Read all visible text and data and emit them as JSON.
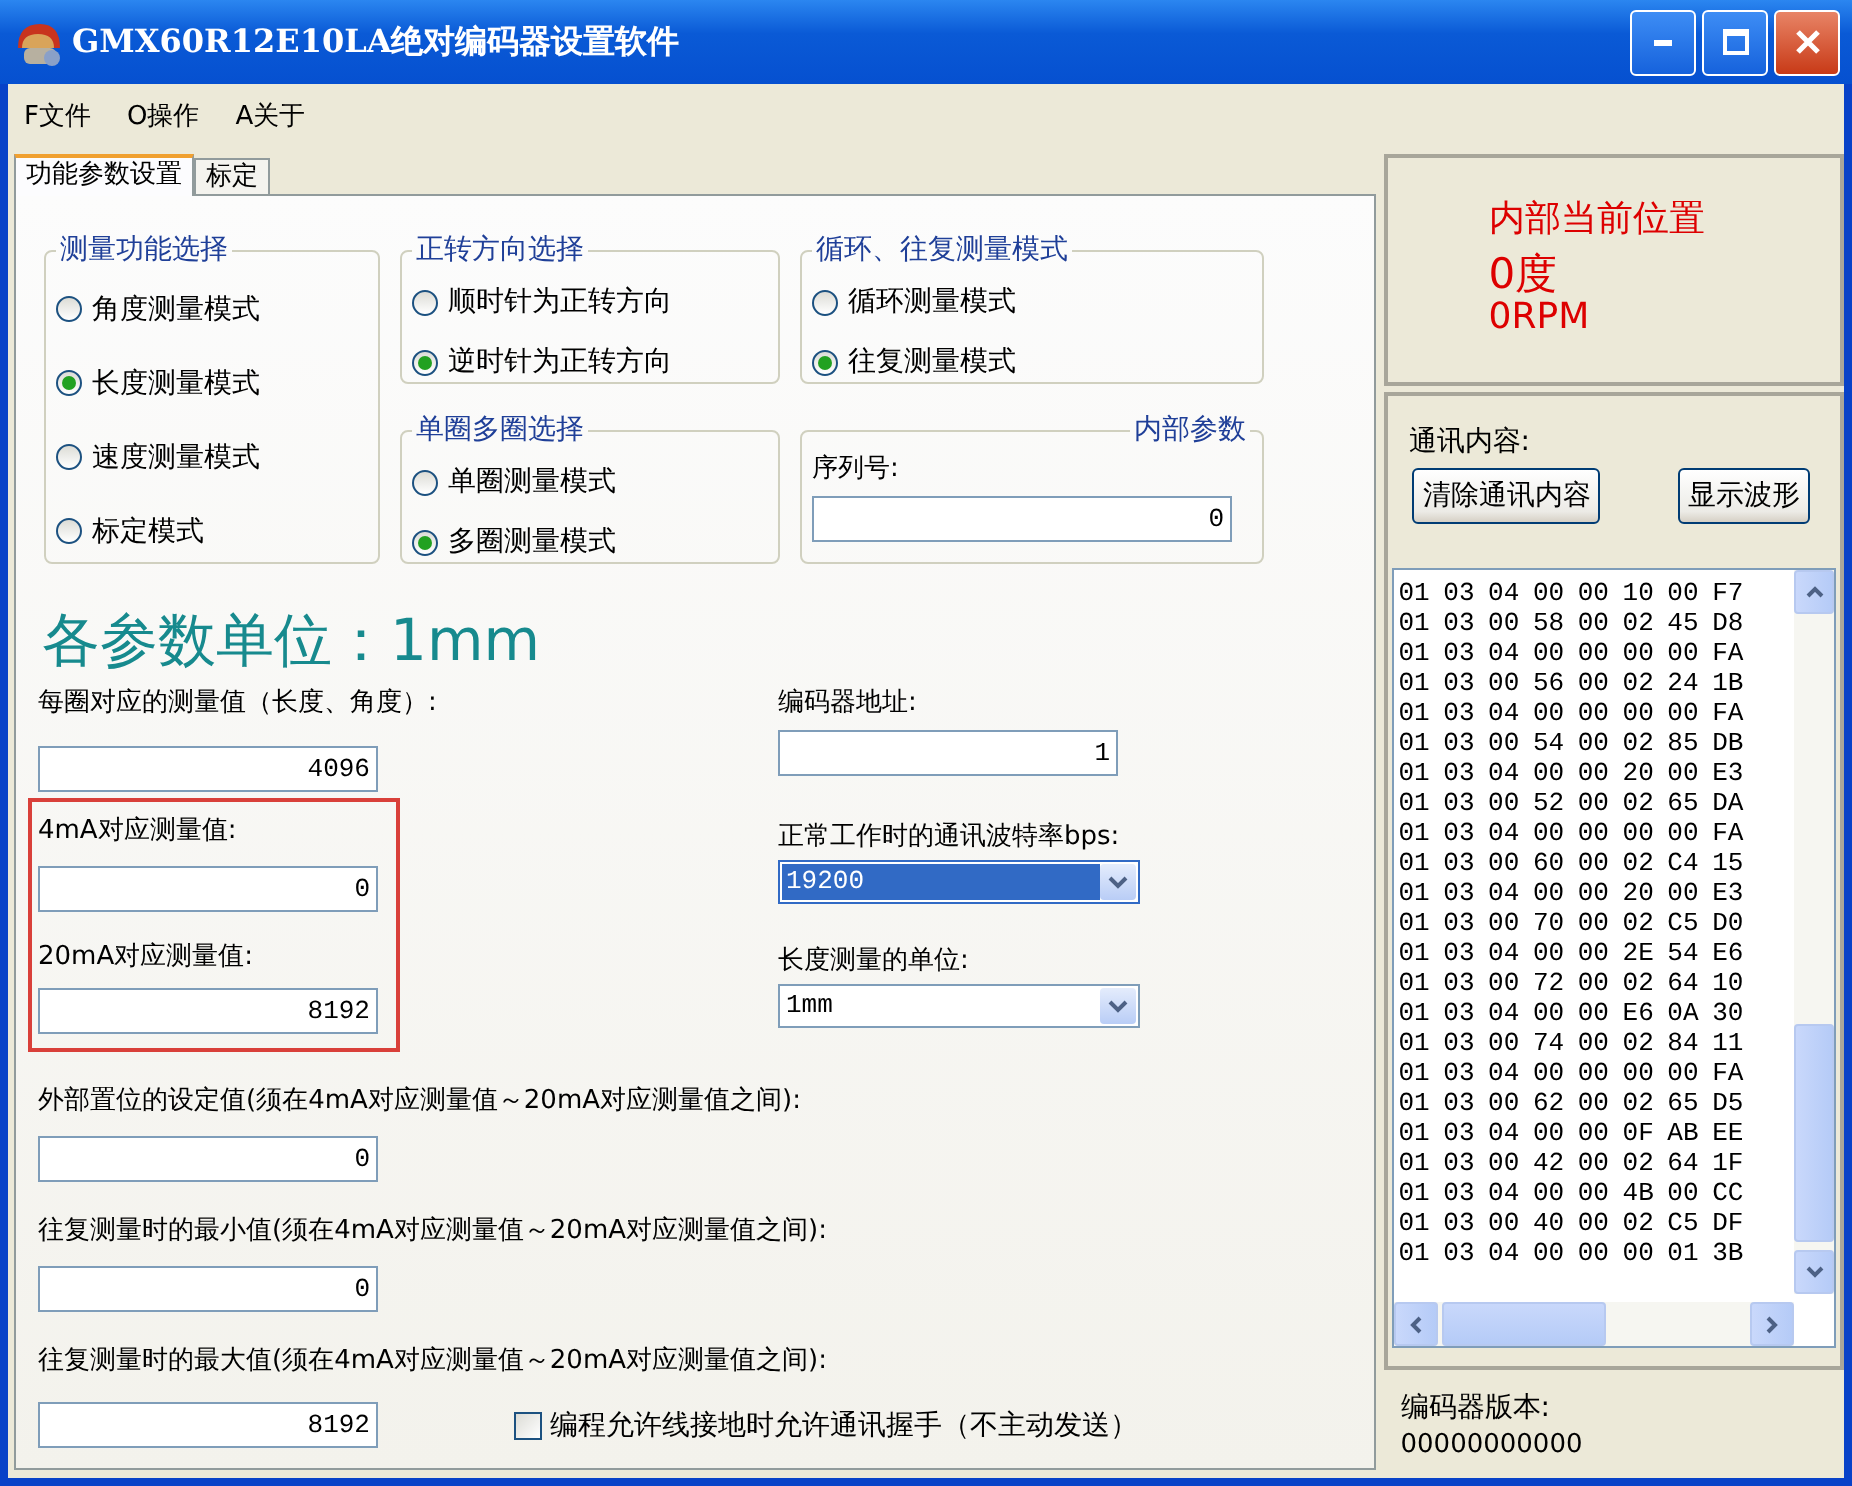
{
  "window": {
    "title": "GMX60R12E10LA绝对编码器设置软件"
  },
  "menu": [
    {
      "label": "F文件"
    },
    {
      "label": "O操作"
    },
    {
      "label": "A关于"
    }
  ],
  "tabs": [
    {
      "label": "功能参数设置",
      "selected": true
    },
    {
      "label": "标定",
      "selected": false
    }
  ],
  "groups": [
    {
      "kind": "radio",
      "title": "测量功能选择",
      "options": [
        {
          "label": "角度测量模式",
          "selected": false
        },
        {
          "label": "长度测量模式",
          "selected": true
        },
        {
          "label": "速度测量模式",
          "selected": false
        },
        {
          "label": "标定模式",
          "selected": false
        }
      ]
    },
    {
      "kind": "radio",
      "title": "正转方向选择",
      "options": [
        {
          "label": "顺时针为正转方向",
          "selected": false
        },
        {
          "label": "逆时针为正转方向",
          "selected": true
        }
      ]
    },
    {
      "kind": "radio",
      "title": "单圈多圈选择",
      "options": [
        {
          "label": "单圈测量模式",
          "selected": false
        },
        {
          "label": "多圈测量模式",
          "selected": true
        }
      ]
    },
    {
      "kind": "radio",
      "title": "循环、往复测量模式",
      "options": [
        {
          "label": "循环测量模式",
          "selected": false
        },
        {
          "label": "往复测量模式",
          "selected": true
        }
      ]
    },
    {
      "kind": "field",
      "title": "内部参数",
      "label": "序列号:",
      "value": "0"
    }
  ],
  "unit_heading": "各参数单位：1mm",
  "left_fields": [
    {
      "label": "每圈对应的测量值（长度、角度）:",
      "value": "4096",
      "highlighted": false
    },
    {
      "label": "4mA对应测量值:",
      "value": "0",
      "highlighted": true
    },
    {
      "label": "20mA对应测量值:",
      "value": "8192",
      "highlighted": true
    }
  ],
  "right_fields": [
    {
      "kind": "text",
      "label": "编码器地址:",
      "value": "1"
    },
    {
      "kind": "dropdown",
      "label": "正常工作时的通讯波特率bps:",
      "value": "19200",
      "focused": true
    },
    {
      "kind": "dropdown",
      "label": "长度测量的单位:",
      "value": "1mm",
      "focused": false
    }
  ],
  "range_fields": [
    {
      "label": "外部置位的设定值(须在4mA对应测量值～20mA对应测量值之间):",
      "value": "0"
    },
    {
      "label": "往复测量时的最小值(须在4mA对应测量值～20mA对应测量值之间):",
      "value": "0"
    },
    {
      "label": "往复测量时的最大值(须在4mA对应测量值～20mA对应测量值之间):",
      "value": "8192"
    }
  ],
  "checkbox": {
    "label": "编程允许线接地时允许通讯握手（不主动发送）",
    "checked": false
  },
  "position": {
    "title": "内部当前位置",
    "angle": "0度",
    "speed": "0RPM"
  },
  "comm": {
    "label": "通讯内容:",
    "buttons": [
      "清除通讯内容",
      "显示波形"
    ],
    "log": [
      "01 03 04 00 00 10 00 F7",
      "01 03 00 58 00 02 45 D8",
      "01 03 04 00 00 00 00 FA",
      "01 03 00 56 00 02 24 1B",
      "01 03 04 00 00 00 00 FA",
      "01 03 00 54 00 02 85 DB",
      "01 03 04 00 00 20 00 E3",
      "01 03 00 52 00 02 65 DA",
      "01 03 04 00 00 00 00 FA",
      "01 03 00 60 00 02 C4 15",
      "01 03 04 00 00 20 00 E3",
      "01 03 00 70 00 02 C5 D0",
      "01 03 04 00 00 2E 54 E6",
      "01 03 00 72 00 02 64 10",
      "01 03 04 00 00 E6 0A 30",
      "01 03 00 74 00 02 84 11",
      "01 03 04 00 00 00 00 FA",
      "01 03 00 62 00 02 65 D5",
      "01 03 04 00 00 0F AB EE",
      "01 03 00 42 00 02 64 1F",
      "01 03 04 00 00 4B 00 CC",
      "01 03 00 40 00 02 C5 DF",
      "01 03 04 00 00 00 01 3B"
    ]
  },
  "version": {
    "label": "编码器版本:",
    "value": "00000000000"
  }
}
